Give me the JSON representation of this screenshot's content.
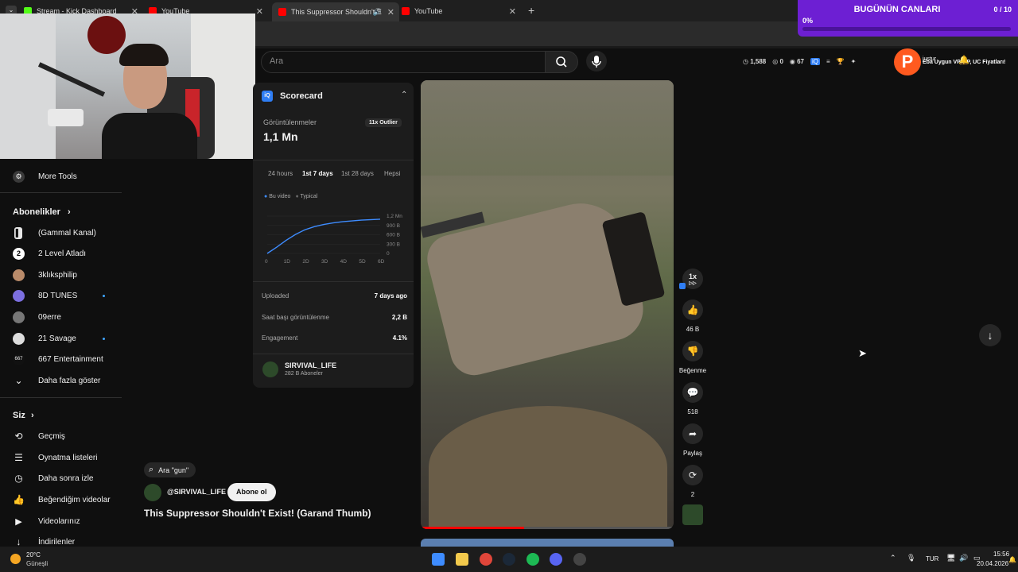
{
  "tabs": [
    {
      "label": "Stream - Kick Dashboard",
      "color": "#53fc18"
    },
    {
      "label": "YouTube",
      "color": "#ff0000"
    },
    {
      "label": "This Suppressor Shouldn't E",
      "color": "#ff0000"
    },
    {
      "label": "YouTube",
      "color": "#ff0000"
    }
  ],
  "overlay": {
    "title": "BUGÜNÜN CANLARI",
    "count": "0 / 10",
    "percent": "0%"
  },
  "search": {
    "placeholder": "Ara"
  },
  "stats": {
    "views": "1,588",
    "zero": "0",
    "eye": "67"
  },
  "user": {
    "handle": "justur",
    "ticker": "Eba Uygun VP, EP, UC Fiyatları!"
  },
  "sidebar": {
    "more_tools": "More Tools",
    "subscriptions_title": "Abonelikler",
    "channels": [
      {
        "label": "(Gammal Kanal)",
        "dot": false
      },
      {
        "label": "2 Level Atladı",
        "dot": false
      },
      {
        "label": "3klıksphilip",
        "dot": false
      },
      {
        "label": "8D TUNES",
        "dot": true
      },
      {
        "label": "09erre",
        "dot": false
      },
      {
        "label": "21 Savage",
        "dot": true
      },
      {
        "label": "667 Entertainment",
        "dot": false
      },
      {
        "label": "Daha fazla göster",
        "dot": false
      }
    ],
    "you_title": "Siz",
    "you_items": [
      {
        "label": "Geçmiş"
      },
      {
        "label": "Oynatma listeleri"
      },
      {
        "label": "Daha sonra izle"
      },
      {
        "label": "Beğendiğim videolar"
      },
      {
        "label": "Videolarınız"
      },
      {
        "label": "İndirilenler"
      }
    ]
  },
  "scorecard": {
    "title": "Scorecard",
    "views_label": "Görüntülenmeler",
    "views_value": "1,1 Mn",
    "outlier": "11x Outlier",
    "ranges": [
      "24 hours",
      "1st 7 days",
      "1st 28 days",
      "Hepsi"
    ],
    "legend": [
      "Bu video",
      "Typical"
    ],
    "y_ticks": [
      "1,2 Mn",
      "900 B",
      "600 B",
      "300 B",
      "0"
    ],
    "x_ticks": [
      "0",
      "1D",
      "2D",
      "3D",
      "4D",
      "5D",
      "6D"
    ],
    "uploaded_label": "Uploaded",
    "uploaded_value": "7 days ago",
    "hourly_label": "Saat başı görüntülenme",
    "hourly_value": "2,2 B",
    "engagement_label": "Engagement",
    "engagement_value": "4.1%",
    "channel_name": "SIRVIVAL_LIFE",
    "channel_subs": "282 B Aboneler"
  },
  "chart_data": {
    "type": "line",
    "x": [
      0,
      0.5,
      1,
      1.5,
      2,
      2.5,
      3,
      3.5,
      4,
      5,
      6
    ],
    "series": [
      {
        "name": "Bu video",
        "values": [
          0,
          200000,
          420000,
          610000,
          760000,
          860000,
          930000,
          980000,
          1020000,
          1070000,
          1100000
        ]
      }
    ],
    "ylim": [
      0,
      1200000
    ]
  },
  "video": {
    "search_chip": "Ara \"gun\"",
    "channel": "@SIRVIVAL_LIFE",
    "subscribe": "Abone ol",
    "title": "This Suppressor Shouldn't Exist! (Garand Thumb)",
    "speed": "1x",
    "likes": "46 B",
    "dislike": "Beğenme",
    "comments": "518",
    "share": "Paylaş",
    "remix": "2"
  },
  "taskbar": {
    "temp": "20°C",
    "weather": "Güneşli",
    "lang": "TUR",
    "time": "15:56",
    "date": "20.04.2026"
  }
}
